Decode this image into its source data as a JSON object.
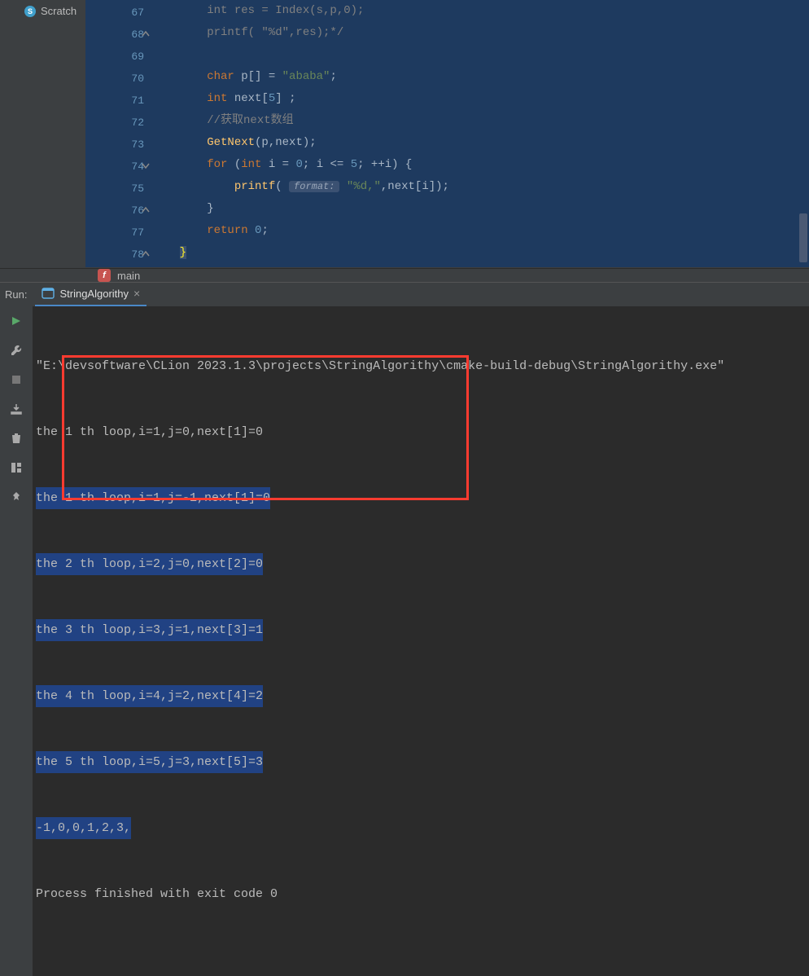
{
  "sidebar": {
    "item_label": "Scratch"
  },
  "editor": {
    "lines": {
      "67": "        int res = Index(s,p,0);",
      "68": "        printf( \"%d\",res);*/",
      "69": "",
      "70": "        char p[] = \"ababa\";",
      "71": "        int next[5] ;",
      "72": "        //获取next数组",
      "73": "        GetNext(p,next);",
      "74": "        for (int i = 0; i <= 5; ++i) {",
      "75": "            printf( format: \"%d,\",next[i]);",
      "76": "        }",
      "77": "        return 0;",
      "78": "    }"
    },
    "line_numbers": [
      "67",
      "68",
      "69",
      "70",
      "71",
      "72",
      "73",
      "74",
      "75",
      "76",
      "77",
      "78"
    ]
  },
  "breadcrumb": {
    "icon_letter": "f",
    "label": "main"
  },
  "run": {
    "label": "Run:",
    "tab_name": "StringAlgorithy"
  },
  "console": {
    "lines": [
      "\"E:\\devsoftware\\CLion 2023.1.3\\projects\\StringAlgorithy\\cmake-build-debug\\StringAlgorithy.exe\"",
      "the 1 th loop,i=1,j=0,next[1]=0",
      "the 1 th loop,i=1,j=-1,next[1]=0",
      "the 2 th loop,i=2,j=0,next[2]=0",
      "the 3 th loop,i=3,j=1,next[3]=1",
      "the 4 th loop,i=4,j=2,next[4]=2",
      "the 5 th loop,i=5,j=3,next[5]=3",
      "-1,0,0,1,2,3,",
      "Process finished with exit code 0"
    ]
  }
}
